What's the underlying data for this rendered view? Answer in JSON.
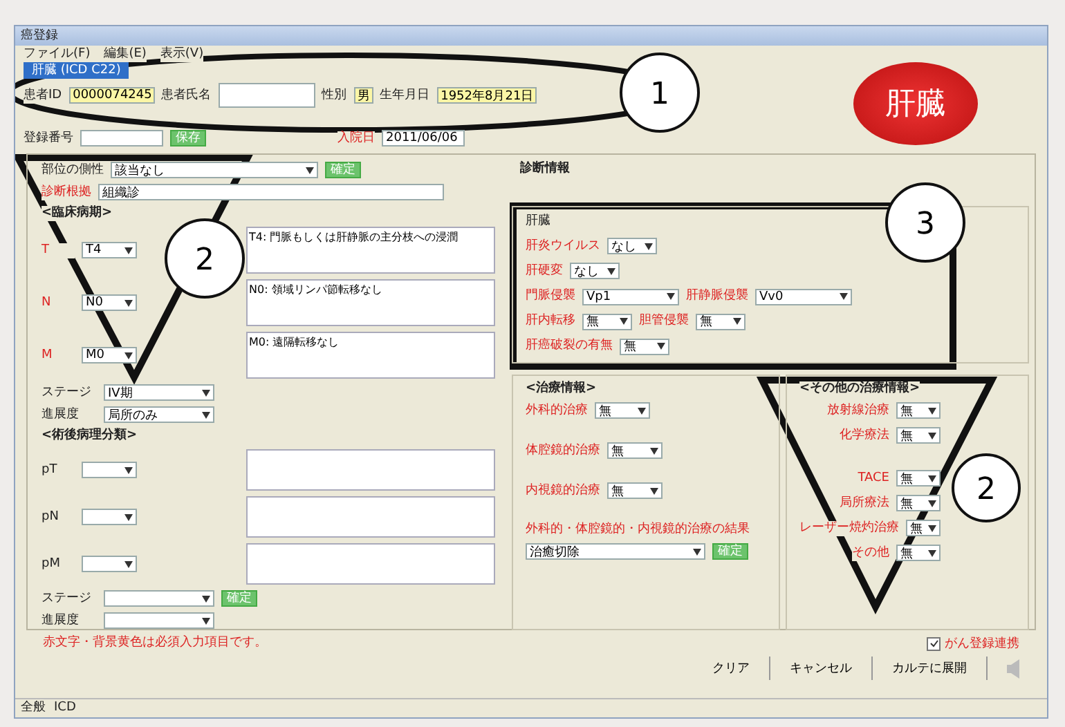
{
  "window": {
    "title": "癌登録"
  },
  "menu": [
    "ファイル(F)",
    "編集(E)",
    "表示(V)"
  ],
  "header": {
    "tab": "肝臓 (ICD C22)",
    "id_label": "患者ID",
    "id": "0000074245",
    "name_label": "患者氏名",
    "sex_label": "性別",
    "sex": "男",
    "birth_label": "生年月日",
    "birth": "1952年8月21日",
    "no_label": "登録番号",
    "admit_label": "入院日",
    "admit": "2011/06/06",
    "save": "保存"
  },
  "organ": "肝臓",
  "section_title": "診断情報",
  "left": {
    "site_label": "部位の側性",
    "site": "該当なし",
    "site_set": "確定",
    "origin_label": "診断根拠",
    "origin": "組織診",
    "tnm_title": "<臨床病期>",
    "tnm": [
      {
        "label": "T",
        "value": "T4",
        "note": "T4: 門脈もしくは肝静脈の主分枝への浸潤"
      },
      {
        "label": "N",
        "value": "N0",
        "note": "N0: 領域リンパ節転移なし"
      },
      {
        "label": "M",
        "value": "M0",
        "note": "M0: 遠隔転移なし"
      }
    ],
    "stage_label": "ステージ",
    "stage": "IV期",
    "extent_label": "進展度",
    "extent": "局所のみ",
    "ptnm_title": "<術後病理分類>",
    "ptnm": [
      {
        "label": "pT"
      },
      {
        "label": "pN"
      },
      {
        "label": "pM"
      }
    ],
    "pstage_label": "ステージ",
    "pstage_set": "確定",
    "pextent_label": "進展度"
  },
  "liver": {
    "title": "肝臓",
    "rows": [
      {
        "kind": "pair",
        "items": [
          {
            "label": "肝炎ウイルス",
            "value": "なし"
          }
        ]
      },
      {
        "kind": "pair",
        "items": [
          {
            "label": "肝硬変",
            "value": "なし"
          }
        ]
      },
      {
        "kind": "pair",
        "items": [
          {
            "label": "門脈侵襲",
            "value": "Vp1"
          },
          {
            "label": "肝静脈侵襲",
            "value": "Vv0"
          }
        ]
      },
      {
        "kind": "pair",
        "items": [
          {
            "label": "肝内転移",
            "value": "無"
          },
          {
            "label": "胆管侵襲",
            "value": "無"
          }
        ]
      },
      {
        "kind": "pair",
        "items": [
          {
            "label": "肝癌破裂の有無",
            "value": "無"
          }
        ]
      }
    ]
  },
  "treatment": {
    "title": "<治療情報>",
    "rows": [
      {
        "label": "外科的治療",
        "value": "無"
      },
      {
        "label": "体腔鏡的治療",
        "value": "無"
      },
      {
        "label": "内視鏡的治療",
        "value": "無"
      }
    ],
    "result_label": "外科的・体腔鏡的・内視鏡的治療の結果",
    "result": "治癒切除",
    "result_set": "確定"
  },
  "other": {
    "title": "<その他の治療情報>",
    "rows": [
      {
        "label": "放射線治療",
        "value": "無"
      },
      {
        "label": "化学療法",
        "value": "無"
      },
      {
        "label": "TACE",
        "value": "無"
      },
      {
        "label": "局所療法",
        "value": "無"
      },
      {
        "label": "レーザー焼灼治療",
        "value": "無"
      },
      {
        "label": "その他",
        "value": "無"
      }
    ]
  },
  "notice": "赤文字・背景黄色は必須入力項目です。",
  "link_check": {
    "label": "がん登録連携",
    "checked": true
  },
  "buttons": [
    "クリア",
    "キャンセル",
    "カルテに展開"
  ],
  "status": [
    "全般",
    "ICD"
  ],
  "callouts": [
    "1",
    "2",
    "3",
    "2"
  ]
}
